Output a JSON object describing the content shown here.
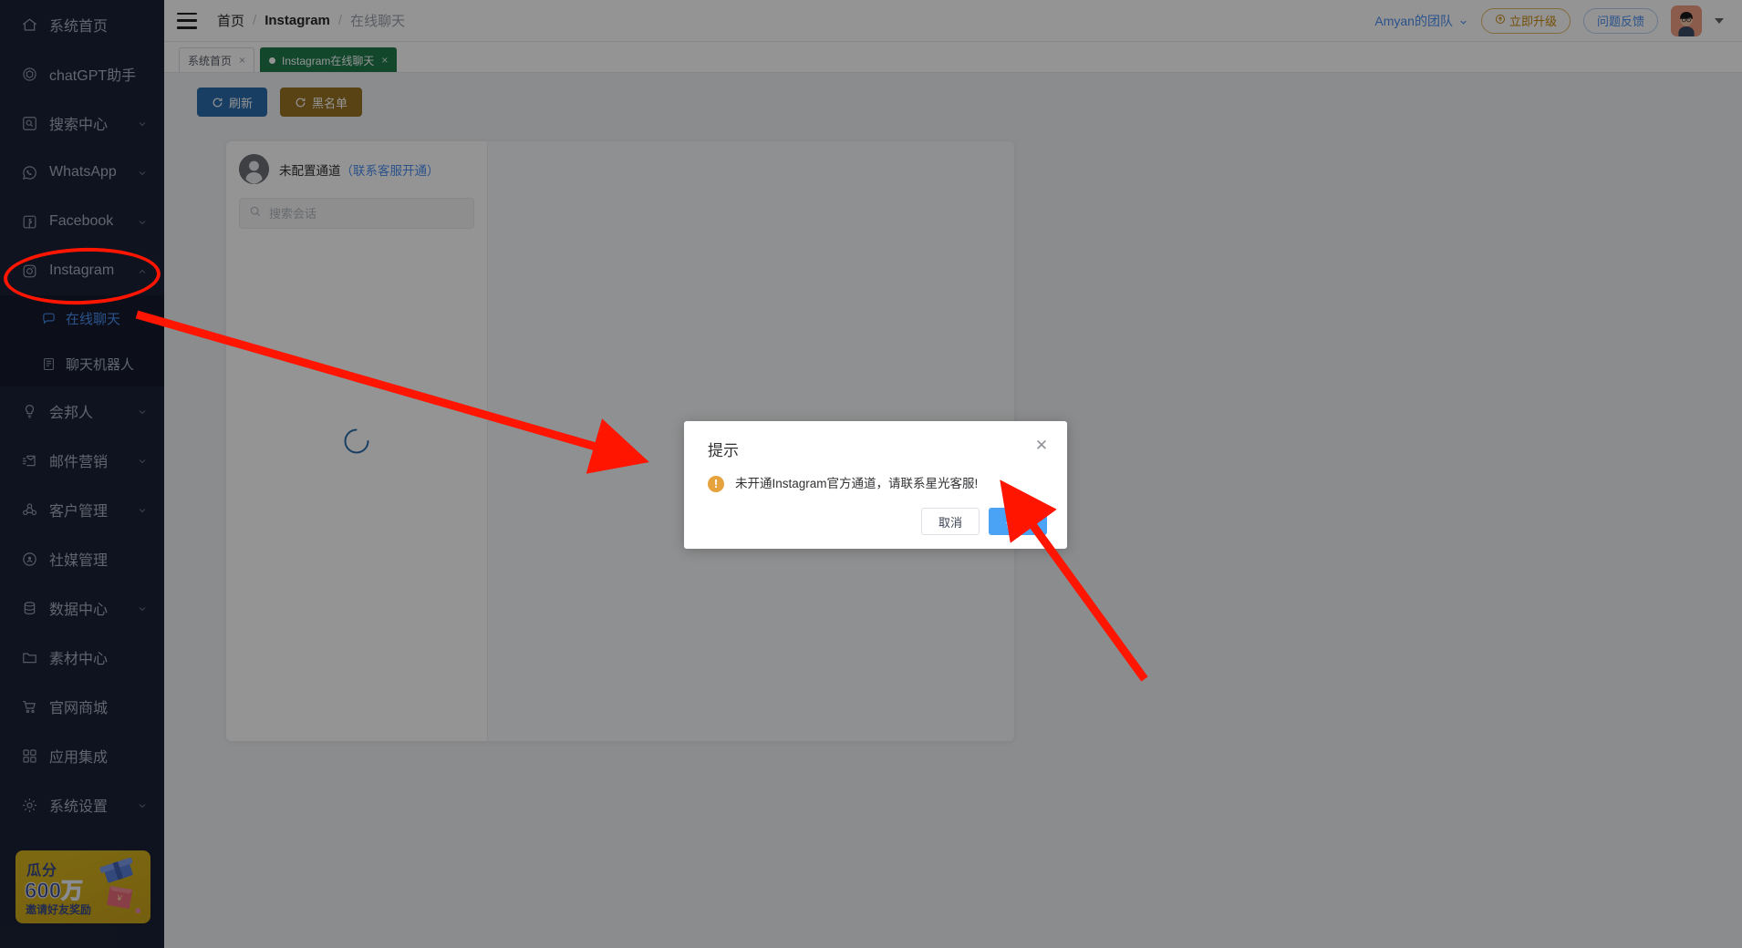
{
  "sidebar": {
    "items": [
      {
        "label": "系统首页",
        "icon": "home-icon",
        "expandable": false
      },
      {
        "label": "chatGPT助手",
        "icon": "chatgpt-icon",
        "expandable": false
      },
      {
        "label": "搜索中心",
        "icon": "search-box-icon",
        "expandable": true
      },
      {
        "label": "WhatsApp",
        "icon": "whatsapp-icon",
        "expandable": true
      },
      {
        "label": "Facebook",
        "icon": "facebook-icon",
        "expandable": true
      },
      {
        "label": "Instagram",
        "icon": "instagram-icon",
        "expandable": true,
        "expanded": true
      },
      {
        "label": "会邦人",
        "icon": "bulb-icon",
        "expandable": true
      },
      {
        "label": "邮件营销",
        "icon": "mail-send-icon",
        "expandable": true
      },
      {
        "label": "客户管理",
        "icon": "users-icon",
        "expandable": true
      },
      {
        "label": "社媒管理",
        "icon": "broadcast-icon",
        "expandable": false
      },
      {
        "label": "数据中心",
        "icon": "database-icon",
        "expandable": true
      },
      {
        "label": "素材中心",
        "icon": "folder-icon",
        "expandable": false
      },
      {
        "label": "官网商城",
        "icon": "cart-icon",
        "expandable": false
      },
      {
        "label": "应用集成",
        "icon": "apps-icon",
        "expandable": false
      },
      {
        "label": "系统设置",
        "icon": "gear-icon",
        "expandable": true
      }
    ],
    "instagram_children": [
      {
        "label": "在线聊天",
        "icon": "chat-bubble-icon",
        "active": true
      },
      {
        "label": "聊天机器人",
        "icon": "robot-doc-icon",
        "active": false
      }
    ],
    "promo": {
      "line1": "瓜分",
      "line2": "600万",
      "line3": "邀请好友奖励"
    }
  },
  "header": {
    "menu_icon": "hamburger-icon",
    "breadcrumb": [
      "首页",
      "Instagram",
      "在线聊天"
    ],
    "team_name": "Amyan的团队",
    "upgrade_label": "立即升级",
    "feedback_label": "问题反馈"
  },
  "tabs": [
    {
      "label": "系统首页",
      "active": false,
      "closable": true
    },
    {
      "label": "Instagram在线聊天",
      "active": true,
      "closable": true
    }
  ],
  "toolbar": {
    "refresh_label": "刷新",
    "blacklist_label": "黑名单"
  },
  "chat": {
    "channel_status": "未配置通道",
    "channel_link": "（联系客服开通）",
    "search_placeholder": "搜索会话",
    "loading": true
  },
  "modal": {
    "title": "提示",
    "message": "未开通Instagram官方通道，请联系星光客服!",
    "cancel_label": "取消",
    "confirm_label": "确定",
    "close_icon": "close-icon"
  },
  "colors": {
    "sidebar_bg": "#1b2236",
    "accent_blue": "#4a8ef0",
    "primary_button": "#2b6bab",
    "warn_button": "#9a7323",
    "active_tab": "#1f7a4d",
    "annotation_red": "#ff1500",
    "confirm_blue": "#4aa3f5"
  }
}
